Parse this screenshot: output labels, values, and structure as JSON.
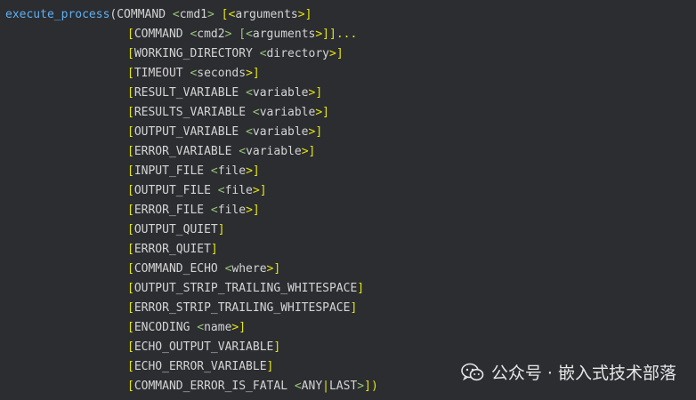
{
  "code": {
    "line1": {
      "fn": "execute_process",
      "a": "(COMMAND ",
      "b": "<",
      "c": "cmd1",
      "d": "> ",
      "e": "[<",
      "f": "arguments",
      "g": ">]"
    },
    "line2": {
      "a": "[",
      "b": "COMMAND ",
      "c": "<",
      "d": "cmd2",
      "e": "> [",
      "f": "<",
      "g": "arguments",
      "h": ">]]..."
    },
    "line3": {
      "a": "[",
      "b": "WORKING_DIRECTORY ",
      "c": "<",
      "d": "directory",
      "e": ">]"
    },
    "line4": {
      "a": "[",
      "b": "TIMEOUT ",
      "c": "<",
      "d": "seconds",
      "e": ">]"
    },
    "line5": {
      "a": "[",
      "b": "RESULT_VARIABLE ",
      "c": "<",
      "d": "variable",
      "e": ">]"
    },
    "line6": {
      "a": "[",
      "b": "RESULTS_VARIABLE ",
      "c": "<",
      "d": "variable",
      "e": ">]"
    },
    "line7": {
      "a": "[",
      "b": "OUTPUT_VARIABLE ",
      "c": "<",
      "d": "variable",
      "e": ">]"
    },
    "line8": {
      "a": "[",
      "b": "ERROR_VARIABLE ",
      "c": "<",
      "d": "variable",
      "e": ">]"
    },
    "line9": {
      "a": "[",
      "b": "INPUT_FILE ",
      "c": "<",
      "d": "file",
      "e": ">]"
    },
    "line10": {
      "a": "[",
      "b": "OUTPUT_FILE ",
      "c": "<",
      "d": "file",
      "e": ">]"
    },
    "line11": {
      "a": "[",
      "b": "ERROR_FILE ",
      "c": "<",
      "d": "file",
      "e": ">]"
    },
    "line12": {
      "a": "[",
      "b": "OUTPUT_QUIET",
      "c": "]"
    },
    "line13": {
      "a": "[",
      "b": "ERROR_QUIET",
      "c": "]"
    },
    "line14": {
      "a": "[",
      "b": "COMMAND_ECHO ",
      "c": "<",
      "d": "where",
      "e": ">]"
    },
    "line15": {
      "a": "[",
      "b": "OUTPUT_STRIP_TRAILING_WHITESPACE",
      "c": "]"
    },
    "line16": {
      "a": "[",
      "b": "ERROR_STRIP_TRAILING_WHITESPACE",
      "c": "]"
    },
    "line17": {
      "a": "[",
      "b": "ENCODING ",
      "c": "<",
      "d": "name",
      "e": ">]"
    },
    "line18": {
      "a": "[",
      "b": "ECHO_OUTPUT_VARIABLE",
      "c": "]"
    },
    "line19": {
      "a": "[",
      "b": "ECHO_ERROR_VARIABLE",
      "c": "]"
    },
    "line20": {
      "a": "[",
      "b": "COMMAND_ERROR_IS_FATAL ",
      "c": "<",
      "d": "ANY",
      "e": "|",
      "f": "LAST",
      "g": ">",
      "h": "])"
    }
  },
  "watermark": {
    "icon": "wechat-icon",
    "text": "公众号 · 嵌入式技术部落"
  },
  "colors": {
    "background": "#2b2d31",
    "function": "#61afef",
    "keyword": "#d4d4d4",
    "bracket": "#e5e510",
    "angle": "#98c379"
  }
}
